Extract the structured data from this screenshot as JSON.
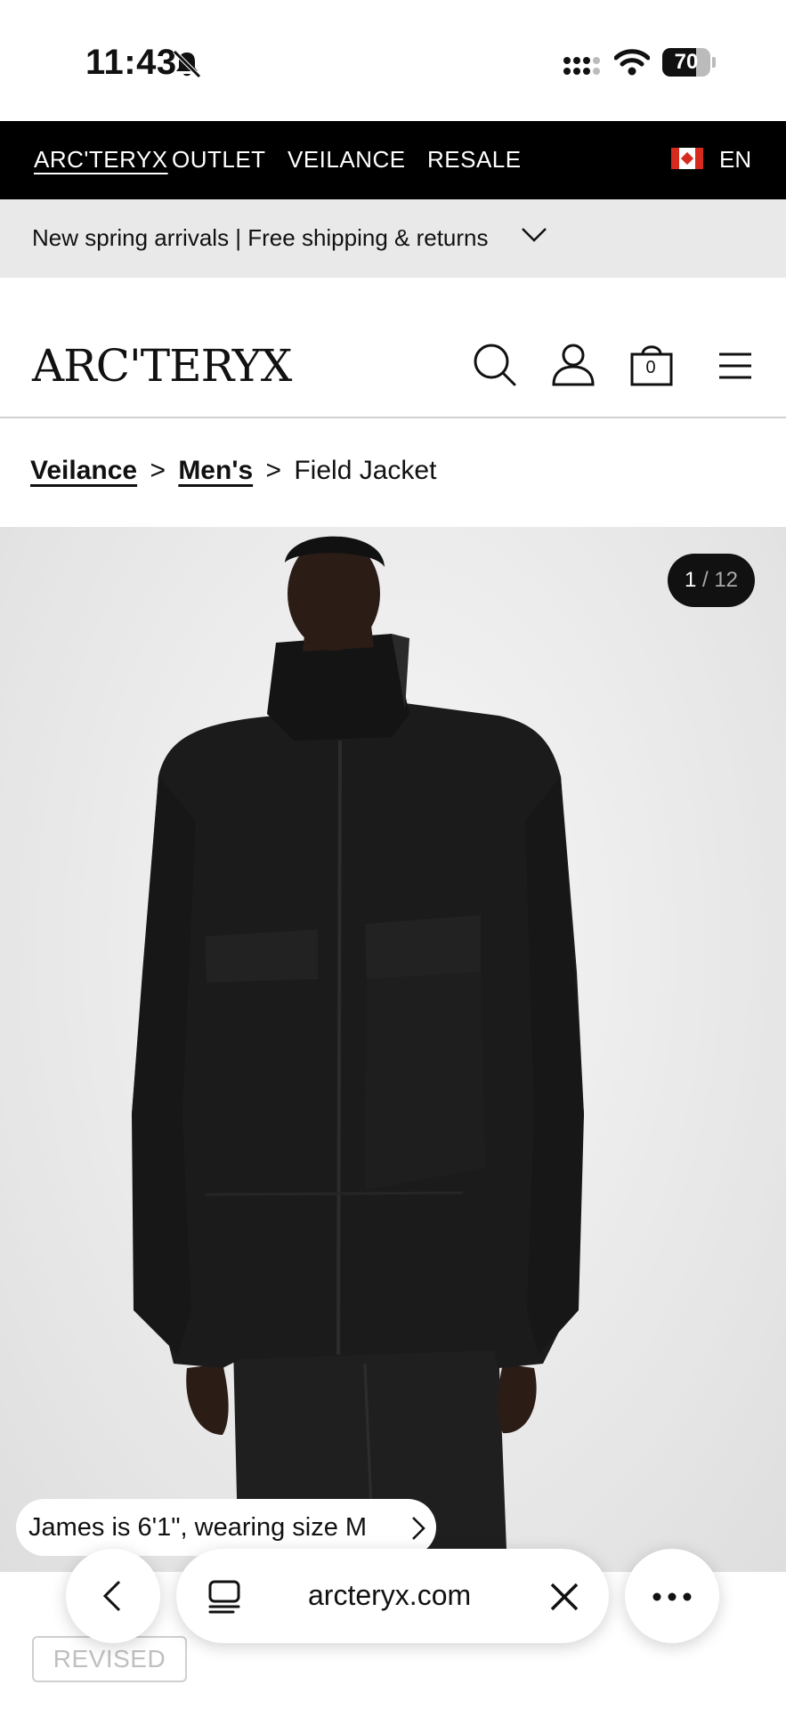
{
  "status_bar": {
    "time": "11:43",
    "battery_percent": 70,
    "battery_label": "70"
  },
  "brand_nav": {
    "items": [
      {
        "label": "ARC'TERYX"
      },
      {
        "label": "OUTLET"
      },
      {
        "label": "VEILANCE"
      },
      {
        "label": "RESALE"
      }
    ],
    "language": "EN"
  },
  "promo": {
    "text": "New spring arrivals | Free shipping & returns"
  },
  "header": {
    "logo": "ARC'TERYX",
    "cart_count": "0"
  },
  "breadcrumb": {
    "items": [
      "Veilance",
      "Men's"
    ],
    "separator": ">",
    "current": "Field Jacket"
  },
  "gallery": {
    "current": "1",
    "separator": "/",
    "total": "12"
  },
  "model_info": {
    "text": "James is 6'1\", wearing size M"
  },
  "badge": {
    "label": "REVISED"
  },
  "browser": {
    "url": "arcteryx.com"
  },
  "colors": {
    "nav_bg": "#000000",
    "promo_bg": "#e9e9e9",
    "counter_bg": "#111111"
  }
}
